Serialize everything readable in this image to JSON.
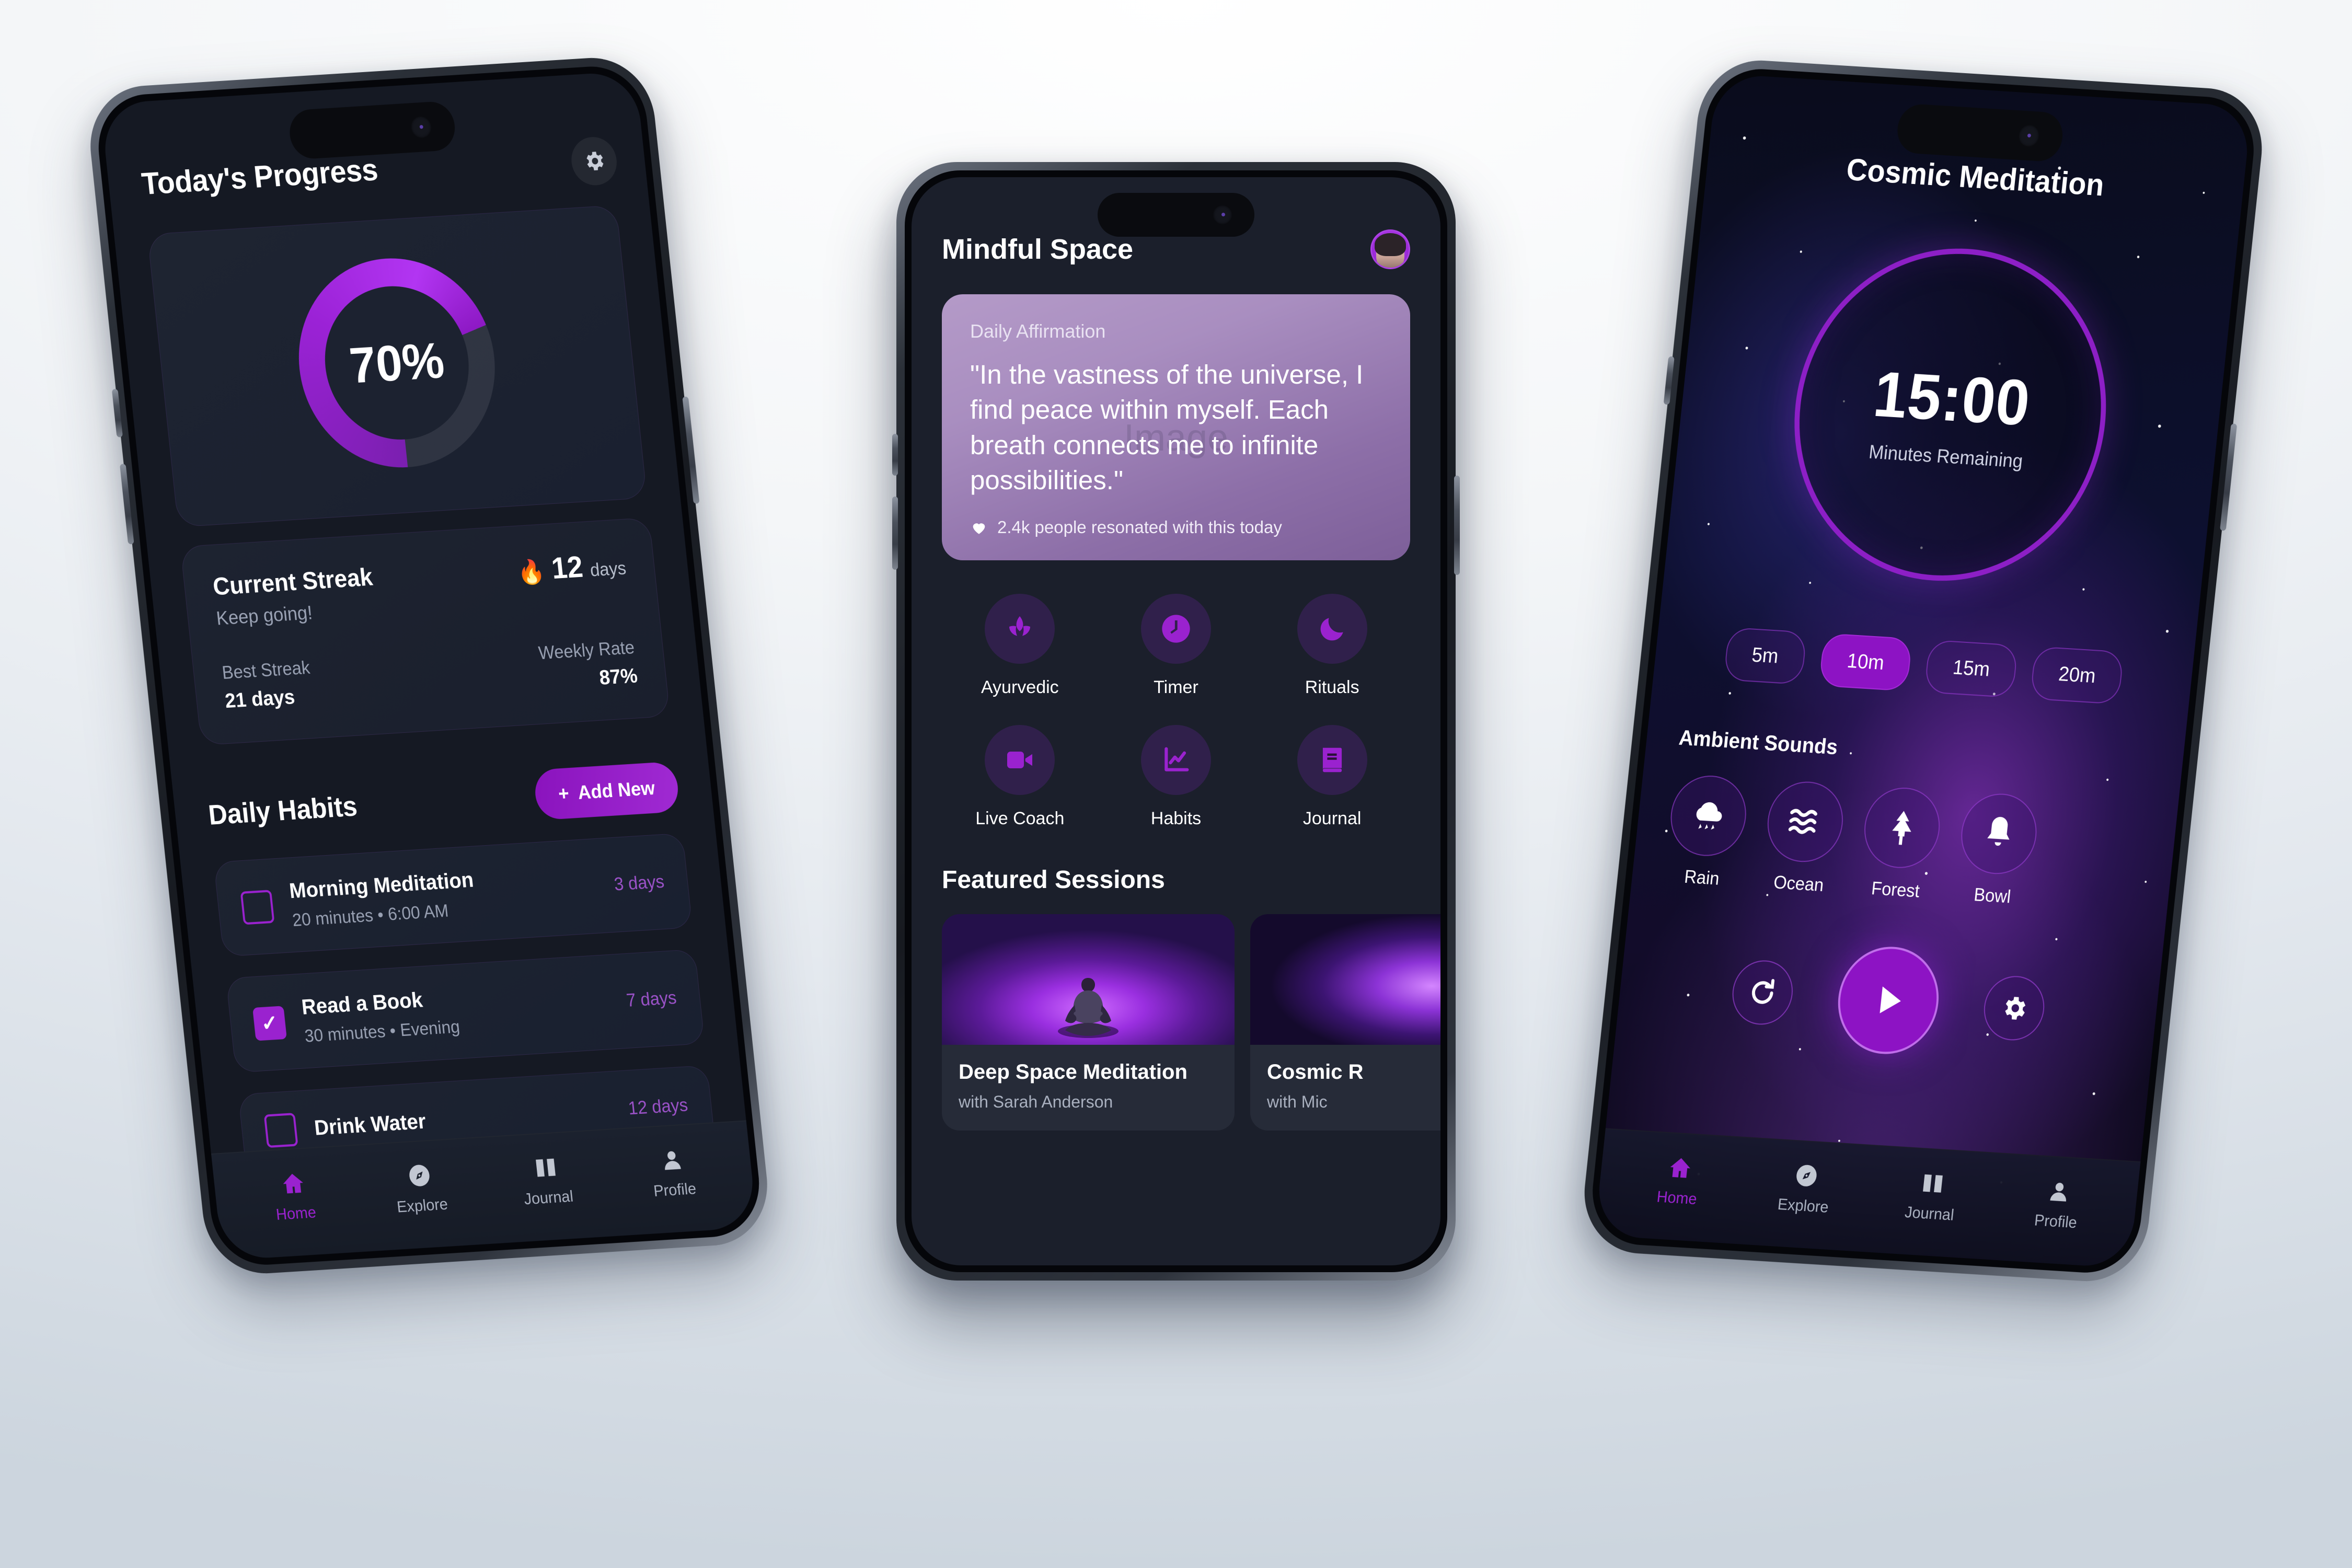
{
  "left_phone": {
    "title": "Today's Progress",
    "gear_icon": "gear-icon",
    "progress": {
      "value": "70%",
      "percent": 70
    },
    "streak": {
      "heading": "Current Streak",
      "subtext": "Keep going!",
      "flame_icon": "flame-icon",
      "count": "12",
      "count_unit": "days",
      "best_label": "Best Streak",
      "best_value": "21 days",
      "rate_label": "Weekly Rate",
      "rate_value": "87%"
    },
    "habits_section": {
      "title": "Daily Habits",
      "add_button": "Add New",
      "add_icon": "plus-icon",
      "items": [
        {
          "name": "Morning Meditation",
          "meta": "20 minutes • 6:00 AM",
          "streak": "3 days",
          "checked": false
        },
        {
          "name": "Read a Book",
          "meta": "30 minutes • Evening",
          "streak": "7 days",
          "checked": true
        },
        {
          "name": "Drink Water",
          "meta": "",
          "streak": "12 days",
          "checked": false
        }
      ]
    },
    "tabs": [
      {
        "label": "Home",
        "icon": "home-icon",
        "active": true
      },
      {
        "label": "Explore",
        "icon": "compass-icon",
        "active": false
      },
      {
        "label": "Journal",
        "icon": "book-icon",
        "active": false
      },
      {
        "label": "Profile",
        "icon": "person-icon",
        "active": false
      }
    ]
  },
  "center_phone": {
    "title": "Mindful Space",
    "avatar_icon": "avatar",
    "affirmation": {
      "label": "Daily Affirmation",
      "watermark": "Image",
      "quote": "\"In the vastness of the universe, I find peace within myself. Each breath connects me to infinite possibilities.\"",
      "heart_icon": "heart-icon",
      "resonated": "2.4k people resonated with this today"
    },
    "quick_actions": [
      {
        "label": "Ayurvedic",
        "icon": "lotus-icon"
      },
      {
        "label": "Timer",
        "icon": "clock-icon"
      },
      {
        "label": "Rituals",
        "icon": "moon-icon"
      },
      {
        "label": "Live Coach",
        "icon": "video-icon"
      },
      {
        "label": "Habits",
        "icon": "chart-line-icon"
      },
      {
        "label": "Journal",
        "icon": "book-closed-icon"
      }
    ],
    "featured_title": "Featured Sessions",
    "featured": [
      {
        "name": "Deep Space Meditation",
        "author": "with Sarah Anderson"
      },
      {
        "name": "Cosmic R",
        "author": "with Mic"
      }
    ]
  },
  "right_phone": {
    "title": "Cosmic Meditation",
    "timer": {
      "value": "15:00",
      "sublabel": "Minutes Remaining"
    },
    "durations": [
      {
        "label": "5m",
        "selected": false
      },
      {
        "label": "10m",
        "selected": true
      },
      {
        "label": "15m",
        "selected": false
      },
      {
        "label": "20m",
        "selected": false
      }
    ],
    "ambient_title": "Ambient Sounds",
    "sounds": [
      {
        "label": "Rain",
        "icon": "rain-cloud-icon"
      },
      {
        "label": "Ocean",
        "icon": "waves-icon"
      },
      {
        "label": "Forest",
        "icon": "tree-icon"
      },
      {
        "label": "Bowl",
        "icon": "bell-icon"
      }
    ],
    "controls": {
      "restart_icon": "restart-icon",
      "play_icon": "play-icon",
      "settings_icon": "gear-icon"
    },
    "tabs": [
      {
        "label": "Home",
        "icon": "home-icon",
        "active": true
      },
      {
        "label": "Explore",
        "icon": "compass-icon",
        "active": false
      },
      {
        "label": "Journal",
        "icon": "book-icon",
        "active": false
      },
      {
        "label": "Profile",
        "icon": "person-icon",
        "active": false
      }
    ]
  },
  "colors": {
    "accent": "#9a22cf",
    "accent_bright": "#b235f2",
    "dark_bg": "#151923",
    "card_bg": "#1d2330",
    "affirmation_top": "#b49ac8",
    "affirmation_bottom": "#7d5f99",
    "muted_text": "#98a0b2"
  }
}
